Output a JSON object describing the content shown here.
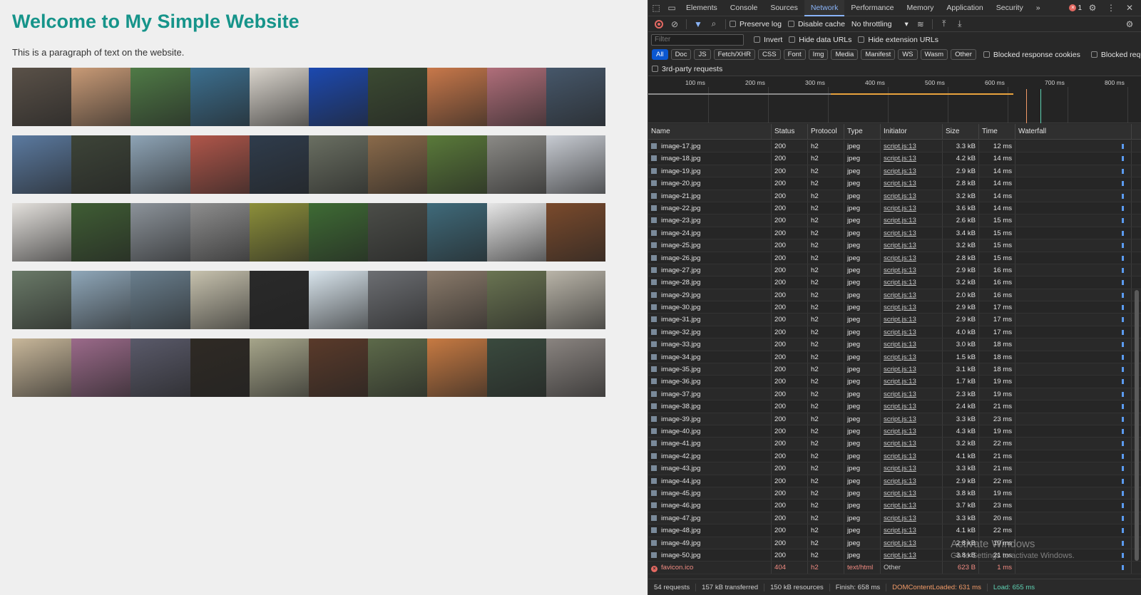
{
  "page": {
    "heading": "Welcome to My Simple Website",
    "paragraph": "This is a paragraph of text on the website.",
    "gallery_rows": [
      [
        "#5a5148",
        "#c89a76",
        "#4f7a46",
        "#3c6f8f",
        "#d9d4cc",
        "#1c49b0",
        "#3b4a32",
        "#c8784a",
        "#b06e7a",
        "#46576a"
      ],
      [
        "#5b7aa0",
        "#3d4438",
        "#8ea4b6",
        "#b0564a",
        "#2f3c4c",
        "#6a6f62",
        "#8a6a4a",
        "#5a7a3a",
        "#8b8a86",
        "#c7cbd2"
      ],
      [
        "#e3e0dc",
        "#3f5d34",
        "#8c939a",
        "#8d8d8d",
        "#8c8f3a",
        "#3e6b34",
        "#4b4d48",
        "#3f6a7a",
        "#e6e6e6",
        "#7a4a2c"
      ],
      [
        "#6a7a68",
        "#8fa7b9",
        "#6a7f8e",
        "#c7c2ae",
        "#2a2a2a",
        "#d8e4ec",
        "#6c6e72",
        "#8a7a6a",
        "#6a7452",
        "#b9b4a8"
      ],
      [
        "#c8b79a",
        "#9b6a8a",
        "#5a5a6a",
        "#2f2a24",
        "#a6a58a",
        "#5a3a2a",
        "#5d6a4a",
        "#c77a42",
        "#3a4a3e",
        "#8a8480"
      ]
    ]
  },
  "devtools": {
    "tabs": [
      "Elements",
      "Console",
      "Sources",
      "Network",
      "Performance",
      "Memory",
      "Application",
      "Security"
    ],
    "active_tab": "Network",
    "more_tabs_icon": "chevron-double-right-icon",
    "error_count": "1",
    "toolbar": {
      "preserve_log": "Preserve log",
      "disable_cache": "Disable cache",
      "throttling": "No throttling"
    },
    "filter": {
      "placeholder": "Filter",
      "invert": "Invert",
      "hide_data_urls": "Hide data URLs",
      "hide_extension_urls": "Hide extension URLs"
    },
    "type_chips": [
      "All",
      "Doc",
      "JS",
      "Fetch/XHR",
      "CSS",
      "Font",
      "Img",
      "Media",
      "Manifest",
      "WS",
      "Wasm",
      "Other"
    ],
    "active_chip": "All",
    "blocked_response_cookies": "Blocked response cookies",
    "blocked_requests": "Blocked requests",
    "third_party": "3rd-party requests",
    "timeline_ticks": [
      "100 ms",
      "200 ms",
      "300 ms",
      "400 ms",
      "500 ms",
      "600 ms",
      "700 ms",
      "800 ms"
    ],
    "columns": [
      "Name",
      "Status",
      "Protocol",
      "Type",
      "Initiator",
      "Size",
      "Time",
      "Waterfall"
    ],
    "rows": [
      {
        "name": "image-17.jpg",
        "status": "200",
        "protocol": "h2",
        "type": "jpeg",
        "initiator": "script.js:13",
        "size": "3.3 kB",
        "time": "12 ms"
      },
      {
        "name": "image-18.jpg",
        "status": "200",
        "protocol": "h2",
        "type": "jpeg",
        "initiator": "script.js:13",
        "size": "4.2 kB",
        "time": "14 ms"
      },
      {
        "name": "image-19.jpg",
        "status": "200",
        "protocol": "h2",
        "type": "jpeg",
        "initiator": "script.js:13",
        "size": "2.9 kB",
        "time": "14 ms"
      },
      {
        "name": "image-20.jpg",
        "status": "200",
        "protocol": "h2",
        "type": "jpeg",
        "initiator": "script.js:13",
        "size": "2.8 kB",
        "time": "14 ms"
      },
      {
        "name": "image-21.jpg",
        "status": "200",
        "protocol": "h2",
        "type": "jpeg",
        "initiator": "script.js:13",
        "size": "3.2 kB",
        "time": "14 ms"
      },
      {
        "name": "image-22.jpg",
        "status": "200",
        "protocol": "h2",
        "type": "jpeg",
        "initiator": "script.js:13",
        "size": "3.6 kB",
        "time": "14 ms"
      },
      {
        "name": "image-23.jpg",
        "status": "200",
        "protocol": "h2",
        "type": "jpeg",
        "initiator": "script.js:13",
        "size": "2.6 kB",
        "time": "15 ms"
      },
      {
        "name": "image-24.jpg",
        "status": "200",
        "protocol": "h2",
        "type": "jpeg",
        "initiator": "script.js:13",
        "size": "3.4 kB",
        "time": "15 ms"
      },
      {
        "name": "image-25.jpg",
        "status": "200",
        "protocol": "h2",
        "type": "jpeg",
        "initiator": "script.js:13",
        "size": "3.2 kB",
        "time": "15 ms"
      },
      {
        "name": "image-26.jpg",
        "status": "200",
        "protocol": "h2",
        "type": "jpeg",
        "initiator": "script.js:13",
        "size": "2.8 kB",
        "time": "15 ms"
      },
      {
        "name": "image-27.jpg",
        "status": "200",
        "protocol": "h2",
        "type": "jpeg",
        "initiator": "script.js:13",
        "size": "2.9 kB",
        "time": "16 ms"
      },
      {
        "name": "image-28.jpg",
        "status": "200",
        "protocol": "h2",
        "type": "jpeg",
        "initiator": "script.js:13",
        "size": "3.2 kB",
        "time": "16 ms"
      },
      {
        "name": "image-29.jpg",
        "status": "200",
        "protocol": "h2",
        "type": "jpeg",
        "initiator": "script.js:13",
        "size": "2.0 kB",
        "time": "16 ms"
      },
      {
        "name": "image-30.jpg",
        "status": "200",
        "protocol": "h2",
        "type": "jpeg",
        "initiator": "script.js:13",
        "size": "2.9 kB",
        "time": "17 ms"
      },
      {
        "name": "image-31.jpg",
        "status": "200",
        "protocol": "h2",
        "type": "jpeg",
        "initiator": "script.js:13",
        "size": "2.9 kB",
        "time": "17 ms"
      },
      {
        "name": "image-32.jpg",
        "status": "200",
        "protocol": "h2",
        "type": "jpeg",
        "initiator": "script.js:13",
        "size": "4.0 kB",
        "time": "17 ms"
      },
      {
        "name": "image-33.jpg",
        "status": "200",
        "protocol": "h2",
        "type": "jpeg",
        "initiator": "script.js:13",
        "size": "3.0 kB",
        "time": "18 ms"
      },
      {
        "name": "image-34.jpg",
        "status": "200",
        "protocol": "h2",
        "type": "jpeg",
        "initiator": "script.js:13",
        "size": "1.5 kB",
        "time": "18 ms"
      },
      {
        "name": "image-35.jpg",
        "status": "200",
        "protocol": "h2",
        "type": "jpeg",
        "initiator": "script.js:13",
        "size": "3.1 kB",
        "time": "18 ms"
      },
      {
        "name": "image-36.jpg",
        "status": "200",
        "protocol": "h2",
        "type": "jpeg",
        "initiator": "script.js:13",
        "size": "1.7 kB",
        "time": "19 ms"
      },
      {
        "name": "image-37.jpg",
        "status": "200",
        "protocol": "h2",
        "type": "jpeg",
        "initiator": "script.js:13",
        "size": "2.3 kB",
        "time": "19 ms"
      },
      {
        "name": "image-38.jpg",
        "status": "200",
        "protocol": "h2",
        "type": "jpeg",
        "initiator": "script.js:13",
        "size": "2.4 kB",
        "time": "21 ms"
      },
      {
        "name": "image-39.jpg",
        "status": "200",
        "protocol": "h2",
        "type": "jpeg",
        "initiator": "script.js:13",
        "size": "3.3 kB",
        "time": "23 ms"
      },
      {
        "name": "image-40.jpg",
        "status": "200",
        "protocol": "h2",
        "type": "jpeg",
        "initiator": "script.js:13",
        "size": "4.3 kB",
        "time": "19 ms"
      },
      {
        "name": "image-41.jpg",
        "status": "200",
        "protocol": "h2",
        "type": "jpeg",
        "initiator": "script.js:13",
        "size": "3.2 kB",
        "time": "22 ms"
      },
      {
        "name": "image-42.jpg",
        "status": "200",
        "protocol": "h2",
        "type": "jpeg",
        "initiator": "script.js:13",
        "size": "4.1 kB",
        "time": "21 ms"
      },
      {
        "name": "image-43.jpg",
        "status": "200",
        "protocol": "h2",
        "type": "jpeg",
        "initiator": "script.js:13",
        "size": "3.3 kB",
        "time": "21 ms"
      },
      {
        "name": "image-44.jpg",
        "status": "200",
        "protocol": "h2",
        "type": "jpeg",
        "initiator": "script.js:13",
        "size": "2.9 kB",
        "time": "22 ms"
      },
      {
        "name": "image-45.jpg",
        "status": "200",
        "protocol": "h2",
        "type": "jpeg",
        "initiator": "script.js:13",
        "size": "3.8 kB",
        "time": "19 ms"
      },
      {
        "name": "image-46.jpg",
        "status": "200",
        "protocol": "h2",
        "type": "jpeg",
        "initiator": "script.js:13",
        "size": "3.7 kB",
        "time": "23 ms"
      },
      {
        "name": "image-47.jpg",
        "status": "200",
        "protocol": "h2",
        "type": "jpeg",
        "initiator": "script.js:13",
        "size": "3.3 kB",
        "time": "20 ms"
      },
      {
        "name": "image-48.jpg",
        "status": "200",
        "protocol": "h2",
        "type": "jpeg",
        "initiator": "script.js:13",
        "size": "4.1 kB",
        "time": "22 ms"
      },
      {
        "name": "image-49.jpg",
        "status": "200",
        "protocol": "h2",
        "type": "jpeg",
        "initiator": "script.js:13",
        "size": "2.8 kB",
        "time": "19 ms"
      },
      {
        "name": "image-50.jpg",
        "status": "200",
        "protocol": "h2",
        "type": "jpeg",
        "initiator": "script.js:13",
        "size": "3.8 kB",
        "time": "21 ms"
      },
      {
        "name": "favicon.ico",
        "status": "404",
        "protocol": "h2",
        "type": "text/html",
        "initiator": "Other",
        "size": "623 B",
        "time": "1 ms",
        "error": true
      }
    ],
    "status_bar": {
      "requests": "54 requests",
      "transferred": "157 kB transferred",
      "resources": "150 kB resources",
      "finish": "Finish: 658 ms",
      "dom_content_loaded": "DOMContentLoaded: 631 ms",
      "load": "Load: 655 ms"
    },
    "colors": {
      "accent": "#8ab4f8",
      "error": "#e46962",
      "dom_content_loaded": "#f29b68",
      "load": "#5fd3b4"
    }
  },
  "watermark": {
    "line1": "Activate Windows",
    "line2": "Go to Settings to activate Windows."
  }
}
